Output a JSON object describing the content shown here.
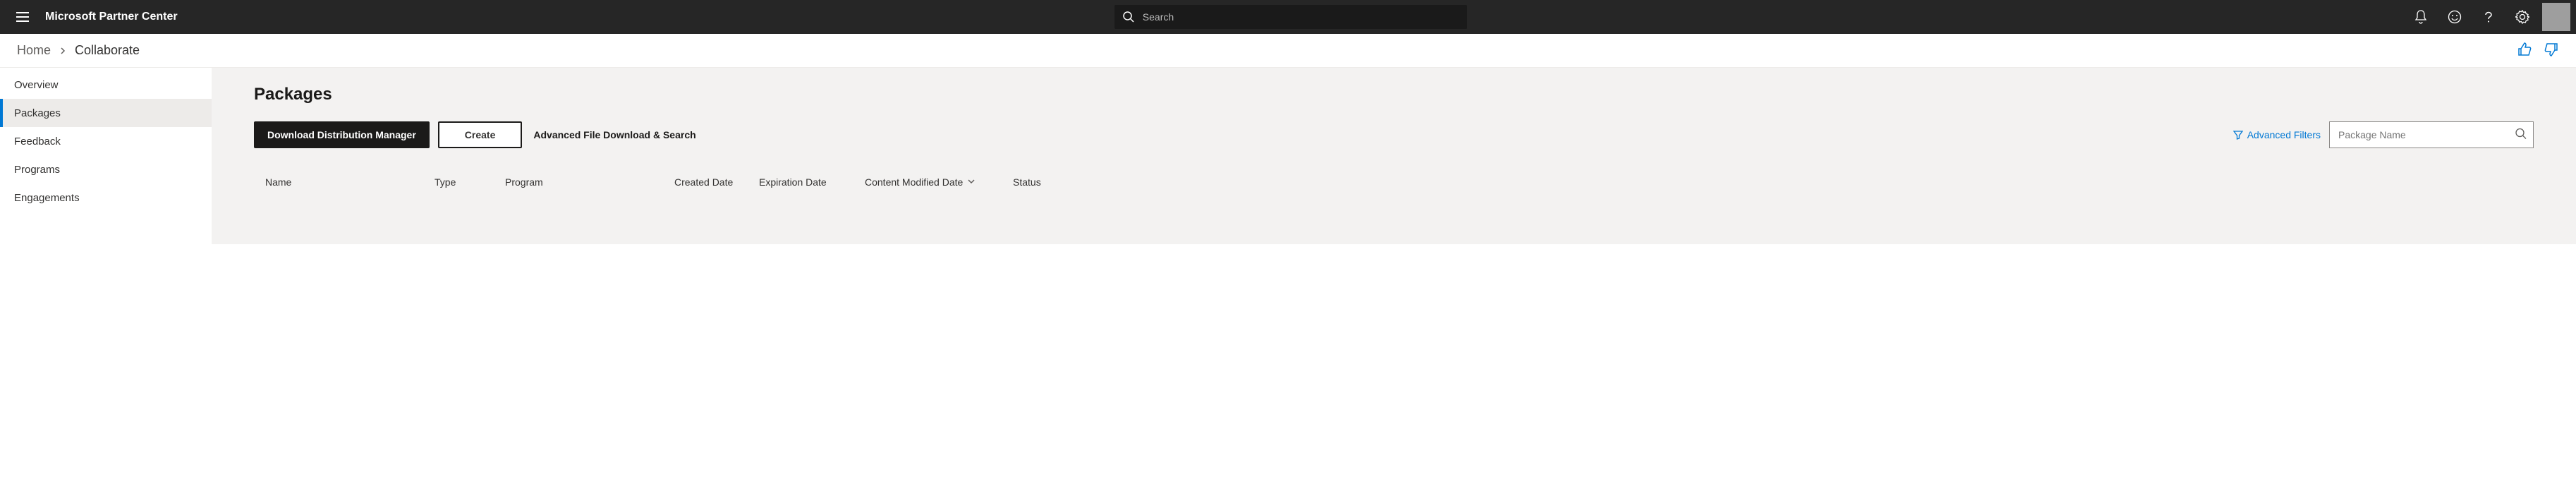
{
  "header": {
    "title": "Microsoft Partner Center",
    "search_placeholder": "Search"
  },
  "breadcrumb": {
    "items": [
      {
        "label": "Home"
      },
      {
        "label": "Collaborate"
      }
    ]
  },
  "sidebar": {
    "items": [
      {
        "label": "Overview",
        "active": false
      },
      {
        "label": "Packages",
        "active": true
      },
      {
        "label": "Feedback",
        "active": false
      },
      {
        "label": "Programs",
        "active": false
      },
      {
        "label": "Engagements",
        "active": false
      }
    ]
  },
  "main": {
    "heading": "Packages",
    "toolbar": {
      "download_dm_label": "Download Distribution Manager",
      "create_label": "Create",
      "advanced_download_label": "Advanced File Download & Search",
      "advanced_filters_label": "Advanced Filters",
      "filter_placeholder": "Package Name"
    },
    "columns": {
      "name": "Name",
      "type": "Type",
      "program": "Program",
      "created": "Created Date",
      "expiration": "Expiration Date",
      "modified": "Content Modified Date",
      "status": "Status"
    }
  },
  "colors": {
    "accent": "#0078d4",
    "header_bg": "#262626",
    "main_bg": "#f3f2f1"
  }
}
